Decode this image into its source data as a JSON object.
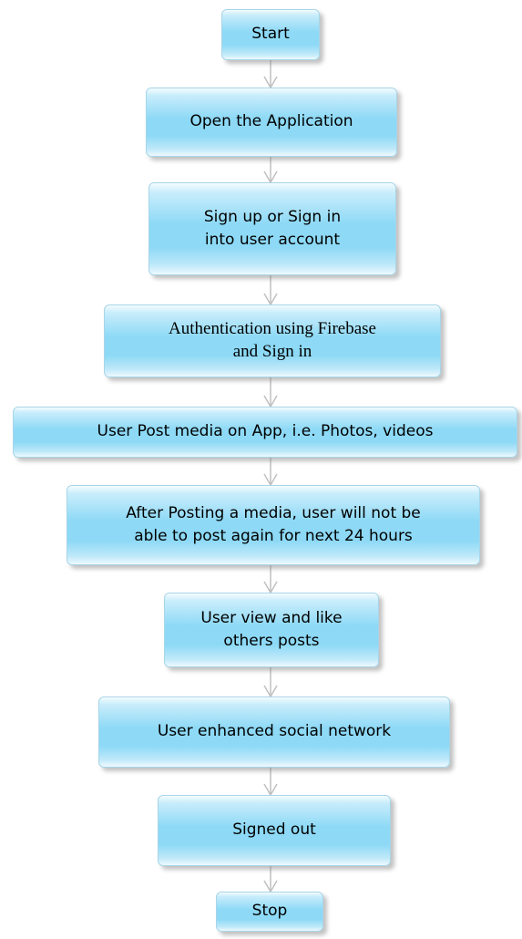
{
  "flowchart": {
    "steps": [
      {
        "id": "start",
        "lines": [
          "Start"
        ]
      },
      {
        "id": "open-app",
        "lines": [
          "Open the Application"
        ]
      },
      {
        "id": "sign-up",
        "lines": [
          "Sign up or Sign in",
          "into user account"
        ]
      },
      {
        "id": "auth",
        "lines": [
          "Authentication using Firebase",
          "and Sign in"
        ]
      },
      {
        "id": "post-media",
        "lines": [
          "User Post media on App, i.e. Photos, videos"
        ]
      },
      {
        "id": "post-limit",
        "lines": [
          "After Posting a media, user will not be",
          "able to post again for next 24 hours"
        ]
      },
      {
        "id": "view-like",
        "lines": [
          "User view and like",
          "others posts"
        ]
      },
      {
        "id": "enhanced",
        "lines": [
          "User enhanced social network"
        ]
      },
      {
        "id": "signed-out",
        "lines": [
          "Signed out"
        ]
      },
      {
        "id": "stop",
        "lines": [
          "Stop"
        ]
      }
    ]
  },
  "colors": {
    "box_fill": "#8dd9f6",
    "box_border": "#a8d5e8",
    "connector": "#c0c0c0"
  }
}
